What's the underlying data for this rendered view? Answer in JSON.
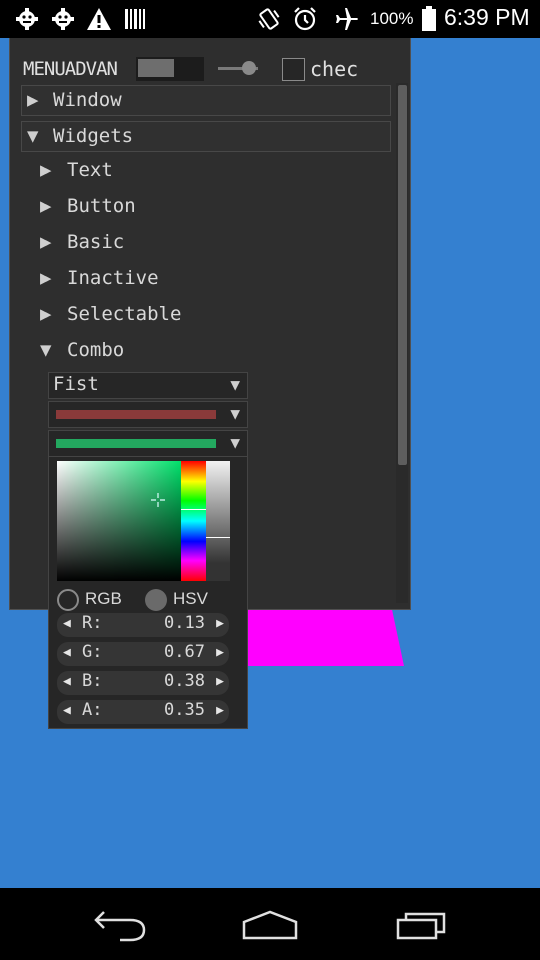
{
  "status_bar": {
    "battery_percent": "100%",
    "time": "6:39 PM",
    "icons": [
      "android-debug-icon",
      "android-debug-icon",
      "warning-icon",
      "barcode-icon",
      "vibrate-icon",
      "alarm-icon",
      "airplane-icon",
      "battery-icon"
    ]
  },
  "menu_bar": {
    "label": "MENUADVAN",
    "checkbox_label": "chec",
    "checkbox_checked": false
  },
  "tree": {
    "window_header": "Window",
    "widgets_header": "Widgets",
    "children": [
      "Text",
      "Button",
      "Basic",
      "Inactive",
      "Selectable",
      "Combo"
    ]
  },
  "combo": {
    "selected": "Fist",
    "color_combo_1": "#8a3a3a",
    "color_combo_2": "#23a85f"
  },
  "color_picker": {
    "mode_rgb_label": "RGB",
    "mode_hsv_label": "HSV",
    "selected_mode": "HSV",
    "channels": [
      {
        "name": "R:",
        "value": "0.13"
      },
      {
        "name": "G:",
        "value": "0.67"
      },
      {
        "name": "B:",
        "value": "0.38"
      },
      {
        "name": "A:",
        "value": "0.35"
      }
    ]
  },
  "colors": {
    "background": "#3480d0",
    "magenta_shape": "#ff00ff",
    "window_bg": "#2e2e2e"
  },
  "nav_bar": {
    "icons": [
      "back-icon",
      "home-icon",
      "recents-icon"
    ]
  }
}
